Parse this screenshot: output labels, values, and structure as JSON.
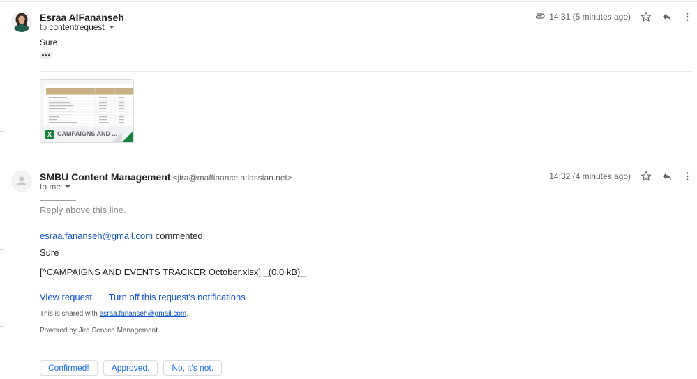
{
  "messages": [
    {
      "sender_name": "Esraa AlFananseh",
      "to_label": "to",
      "to_name": "contentrequest",
      "time": "14:31 (5 minutes ago)",
      "body": "Sure",
      "attachment": {
        "name": "CAMPAIGNS AND ...",
        "icon": "excel-icon",
        "icon_letter": "X"
      }
    },
    {
      "sender_name": "SMBU Content Management",
      "sender_email": "<jira@maffinance.atlassian.net>",
      "to_label": "to me",
      "time": "14:32 (4 minutes ago)",
      "reply_above": "Reply above this line.",
      "commenter_email": "esraa.fananseh@gmail.com",
      "commented_label": "commented:",
      "body": "Sure",
      "attachment_ref": "[^CAMPAIGNS AND EVENTS TRACKER October.xlsx] _(0.0 kB)_",
      "links": {
        "view_request": "View request",
        "separator": "·",
        "turn_off": "Turn off this request's notifications"
      },
      "shared_prefix": "This is shared with",
      "shared_email": "esraa.fananseh@gmail.com",
      "shared_suffix": ".",
      "powered_by": "Powered by Jira Service Management"
    }
  ],
  "smart_replies": [
    "Confirmed!",
    "Approved.",
    "No, it's not."
  ],
  "icons": [
    "avatar-photo-icon",
    "default-avatar-icon",
    "paperclip-icon",
    "star-icon",
    "reply-icon",
    "more-vert-icon",
    "chevron-down-icon"
  ],
  "colors": {
    "link": "#1155cc",
    "smart_reply_text": "#1a73e8",
    "excel_green": "#188038"
  }
}
